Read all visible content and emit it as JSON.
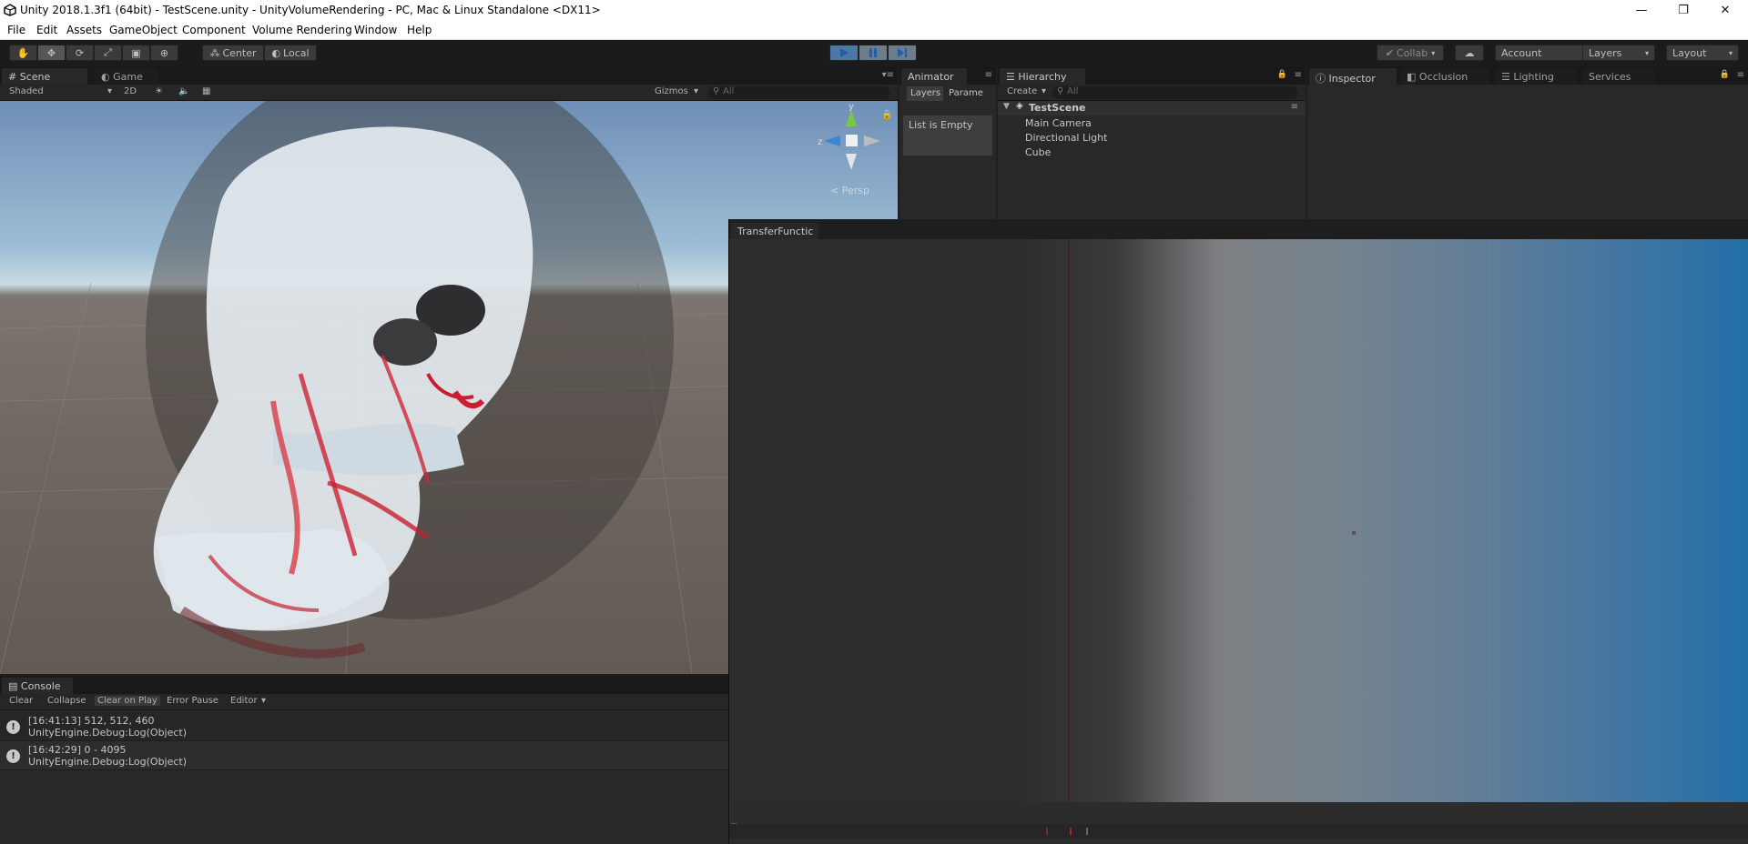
{
  "window": {
    "title": "Unity 2018.1.3f1 (64bit) - TestScene.unity - UnityVolumeRendering - PC, Mac & Linux Standalone <DX11>",
    "minimize": "—",
    "restore": "❐",
    "close": "✕"
  },
  "menu": [
    "File",
    "Edit",
    "Assets",
    "GameObject",
    "Component",
    "Volume Rendering",
    "Window",
    "Help"
  ],
  "toolbar": {
    "pivot": "Center",
    "space": "Local",
    "collab": "Collab",
    "account": "Account",
    "layers": "Layers",
    "layout": "Layout",
    "play_state": "playing"
  },
  "scene_panel": {
    "tab_scene": "Scene",
    "tab_game": "Game",
    "shading_mode": "Shaded",
    "mode_2d": "2D",
    "gizmos": "Gizmos",
    "search_placeholder": "All",
    "persp_label": "Persp",
    "axis_y": "y",
    "axis_z": "z"
  },
  "animator_panel": {
    "tab": "Animator",
    "layers_tab": "Layers",
    "params_tab": "Parame",
    "empty_text": "List is Empty"
  },
  "hierarchy_panel": {
    "tab": "Hierarchy",
    "create": "Create",
    "search_placeholder": "All",
    "scene_name": "TestScene",
    "items": [
      "Main Camera",
      "Directional Light",
      "Cube"
    ]
  },
  "inspector_panel": {
    "tabs": [
      "Inspector",
      "Occlusion",
      "Lighting",
      "Services"
    ]
  },
  "transfer_function": {
    "tab": "TransferFunctic"
  },
  "console_panel": {
    "tab": "Console",
    "buttons": [
      "Clear",
      "Collapse",
      "Clear on Play",
      "Error Pause",
      "Editor"
    ],
    "entries": [
      {
        "line1": "[16:41:13] 512, 512, 460",
        "line2": "UnityEngine.Debug:Log(Object)"
      },
      {
        "line1": "[16:42:29] 0  -  4095",
        "line2": "UnityEngine.Debug:Log(Object)"
      }
    ]
  }
}
